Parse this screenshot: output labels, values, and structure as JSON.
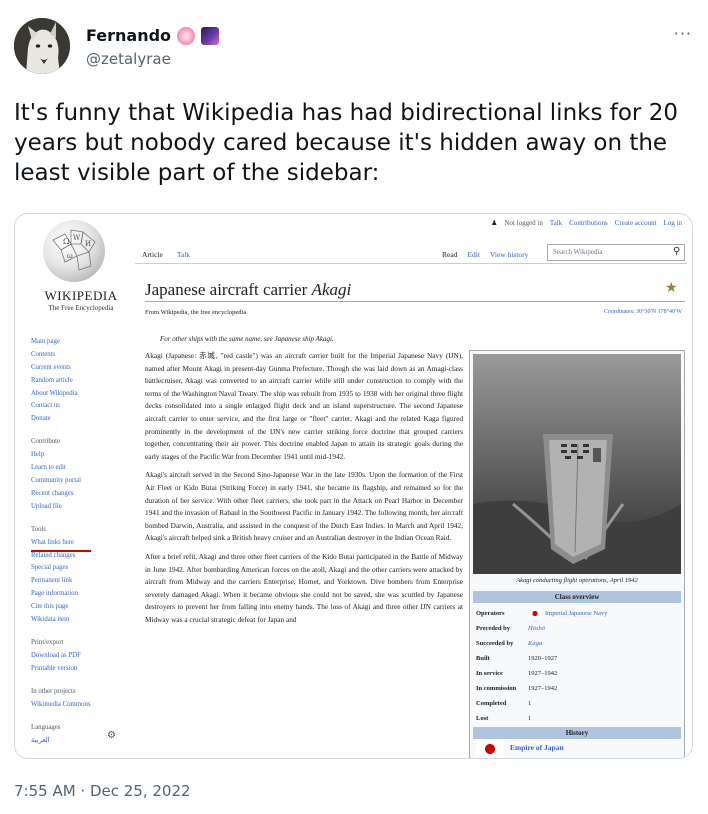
{
  "tweet": {
    "author_name": "Fernando",
    "handle": "@zetalyrae",
    "emojis": [
      "hibiscus-icon",
      "milky-way-icon"
    ],
    "text": "It's funny that Wikipedia has had bidirectional links for 20 years but nobody cared because it's hidden away on the least visible part of the sidebar:",
    "timestamp": "7:55 AM · Dec 25, 2022",
    "more_label": "···"
  },
  "wiki": {
    "top_links": [
      "Not logged in",
      "Talk",
      "Contributions",
      "Create account",
      "Log in"
    ],
    "logo_word": "WIKIPEDIA",
    "logo_tagline": "The Free Encyclopedia",
    "tabs_left": [
      "Article",
      "Talk"
    ],
    "tabs_right": [
      "Read",
      "Edit",
      "View history"
    ],
    "search_placeholder": "Search Wikipedia",
    "sidebar": {
      "nav": [
        "Main page",
        "Contents",
        "Current events",
        "Random article",
        "About Wikipedia",
        "Contact us",
        "Donate"
      ],
      "contribute_heading": "Contribute",
      "contribute": [
        "Help",
        "Learn to edit",
        "Community portal",
        "Recent changes",
        "Upload file"
      ],
      "tools_heading": "Tools",
      "tools": [
        "What links here",
        "Related changes",
        "Special pages",
        "Permanent link",
        "Page information",
        "Cite this page",
        "Wikidata item"
      ],
      "print_heading": "Print/export",
      "print": [
        "Download as PDF",
        "Printable version"
      ],
      "other_heading": "In other projects",
      "other": [
        "Wikimedia Commons"
      ],
      "languages_heading": "Languages",
      "languages": [
        "العربية"
      ]
    },
    "title_plain": "Japanese aircraft carrier ",
    "title_italic": "Akagi",
    "from_wiki": "From Wikipedia, the free encyclopedia",
    "coords": "Coordinates: 30°30′N 178°40′W",
    "hatnote": "For other ships with the same name, see Japanese ship Akagi.",
    "paragraphs": [
      "Akagi (Japanese: 赤城, \"red castle\") was an aircraft carrier built for the Imperial Japanese Navy (IJN), named after Mount Akagi in present-day Gunma Prefecture. Though she was laid down as an Amagi-class battlecruiser, Akagi was converted to an aircraft carrier while still under construction to comply with the terms of the Washington Naval Treaty. The ship was rebuilt from 1935 to 1938 with her original three flight decks consolidated into a single enlarged flight deck and an island superstructure. The second Japanese aircraft carrier to enter service, and the first large or \"fleet\" carrier, Akagi and the related Kaga figured prominently in the development of the IJN's new carrier striking force doctrine that grouped carriers together, concentrating their air power. This doctrine enabled Japan to attain its strategic goals during the early stages of the Pacific War from December 1941 until mid-1942.",
      "Akagi's aircraft served in the Second Sino-Japanese War in the late 1930s. Upon the formation of the First Air Fleet or Kido Butai (Striking Force) in early 1941, she became its flagship, and remained so for the duration of her service. With other fleet carriers, she took part in the Attack on Pearl Harbor in December 1941 and the invasion of Rabaul in the Southwest Pacific in January 1942. The following month, her aircraft bombed Darwin, Australia, and assisted in the conquest of the Dutch East Indies. In March and April 1942, Akagi's aircraft helped sink a British heavy cruiser and an Australian destroyer in the Indian Ocean Raid.",
      "After a brief refit, Akagi and three other fleet carriers of the Kido Butai participated in the Battle of Midway in June 1942. After bombarding American forces on the atoll, Akagi and the other carriers were attacked by aircraft from Midway and the carriers Enterprise, Hornet, and Yorktown. Dive bombers from Enterprise severely damaged Akagi. When it became obvious she could not be saved, she was scuttled by Japanese destroyers to prevent her from falling into enemy hands. The loss of Akagi and three other IJN carriers at Midway was a crucial strategic defeat for Japan and"
    ],
    "infobox": {
      "caption": "Akagi conducting flight operations, April 1942",
      "class_overview": "Class overview",
      "rows": [
        {
          "k": "Operators",
          "v": "Imperial Japanese Navy"
        },
        {
          "k": "Preceded by",
          "v": "Hōshō"
        },
        {
          "k": "Succeeded by",
          "v": "Kaga"
        },
        {
          "k": "Built",
          "v": "1920–1927"
        },
        {
          "k": "In service",
          "v": "1927–1942"
        },
        {
          "k": "In commission",
          "v": "1927–1942"
        },
        {
          "k": "Completed",
          "v": "1"
        },
        {
          "k": "Lost",
          "v": "1"
        }
      ],
      "history": "History",
      "empire": "Empire of Japan"
    }
  }
}
